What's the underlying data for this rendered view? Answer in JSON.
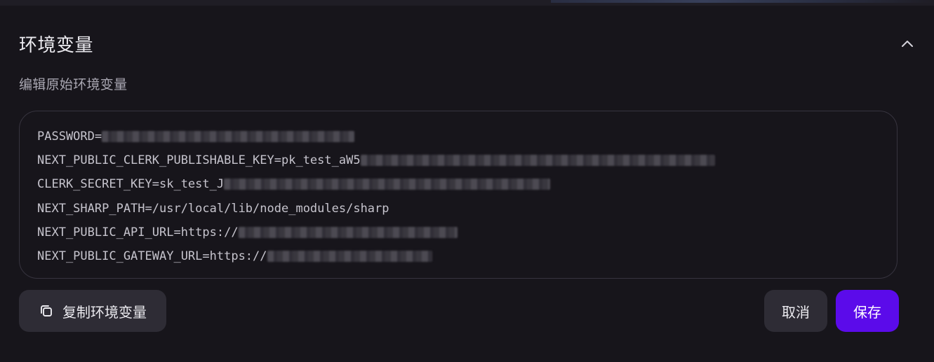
{
  "section": {
    "title": "环境变量",
    "subtitle": "编辑原始环境变量",
    "collapse_icon": "chevron-up-icon"
  },
  "env_lines": [
    {
      "key_prefix": "PASSWORD=",
      "redacted": true
    },
    {
      "key_prefix": "NEXT_PUBLIC_CLERK_PUBLISHABLE_KEY=pk_test_aW5",
      "redacted": true
    },
    {
      "key_prefix": "CLERK_SECRET_KEY=sk_test_J",
      "redacted": true
    },
    {
      "key_prefix": "NEXT_SHARP_PATH=/usr/local/lib/node_modules/sharp",
      "redacted": false
    },
    {
      "key_prefix": "NEXT_PUBLIC_API_URL=https://",
      "redacted": true
    },
    {
      "key_prefix": "NEXT_PUBLIC_GATEWAY_URL=https://",
      "redacted": true
    }
  ],
  "actions": {
    "copy_label": "复制环境变量",
    "copy_icon": "copy-icon",
    "cancel_label": "取消",
    "save_label": "保存"
  },
  "colors": {
    "background": "#17151b",
    "accent": "#5b0bea",
    "button_secondary": "#2e2c35"
  }
}
